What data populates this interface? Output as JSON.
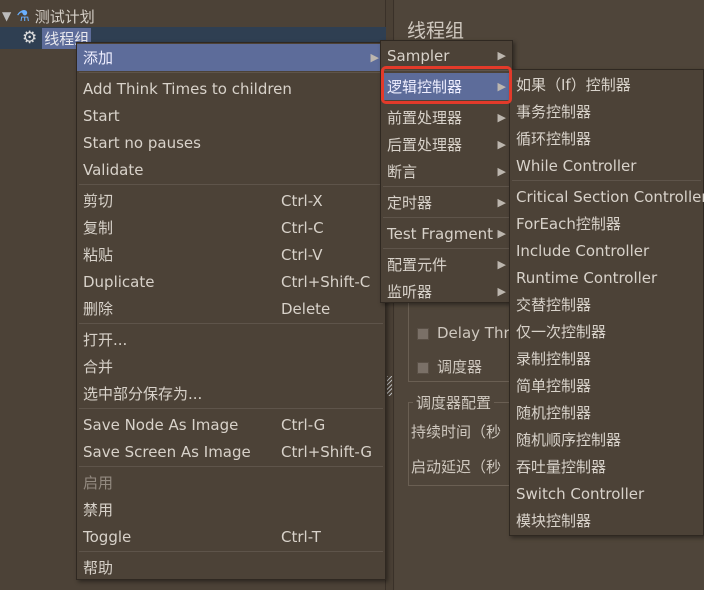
{
  "tree": {
    "root": "测试计划",
    "child": "线程组"
  },
  "panel": {
    "title": "线程组",
    "delay": "Delay Thre",
    "scheduler": "调度器",
    "sched_config": "调度器配置",
    "duration": "持续时间（秒",
    "startup_delay": "启动延迟（秒"
  },
  "menu1": [
    {
      "label": "添加",
      "sub": true,
      "hl": true
    },
    {
      "sep": true
    },
    {
      "label": "Add Think Times to children"
    },
    {
      "label": "Start"
    },
    {
      "label": "Start no pauses"
    },
    {
      "label": "Validate"
    },
    {
      "sep": true
    },
    {
      "label": "剪切",
      "shortcut": "Ctrl-X"
    },
    {
      "label": "复制",
      "shortcut": "Ctrl-C"
    },
    {
      "label": "粘贴",
      "shortcut": "Ctrl-V"
    },
    {
      "label": "Duplicate",
      "shortcut": "Ctrl+Shift-C"
    },
    {
      "label": "删除",
      "shortcut": "Delete"
    },
    {
      "sep": true
    },
    {
      "label": "打开..."
    },
    {
      "label": "合并"
    },
    {
      "label": "选中部分保存为..."
    },
    {
      "sep": true
    },
    {
      "label": "Save Node As Image",
      "shortcut": "Ctrl-G"
    },
    {
      "label": "Save Screen As Image",
      "shortcut": "Ctrl+Shift-G"
    },
    {
      "sep": true
    },
    {
      "label": "启用",
      "disabled": true
    },
    {
      "label": "禁用"
    },
    {
      "label": "Toggle",
      "shortcut": "Ctrl-T"
    },
    {
      "sep": true
    },
    {
      "label": "帮助"
    }
  ],
  "menu2": [
    {
      "label": "Sampler",
      "sub": true
    },
    {
      "sep": true
    },
    {
      "label": "逻辑控制器",
      "sub": true,
      "hl": true
    },
    {
      "sep": true
    },
    {
      "label": "前置处理器",
      "sub": true
    },
    {
      "label": "后置处理器",
      "sub": true
    },
    {
      "label": "断言",
      "sub": true
    },
    {
      "sep": true
    },
    {
      "label": "定时器",
      "sub": true
    },
    {
      "sep": true
    },
    {
      "label": "Test Fragment",
      "sub": true
    },
    {
      "sep": true
    },
    {
      "label": "配置元件",
      "sub": true
    },
    {
      "label": "监听器",
      "sub": true
    }
  ],
  "menu3": [
    {
      "label": "如果（If）控制器"
    },
    {
      "label": "事务控制器"
    },
    {
      "label": "循环控制器"
    },
    {
      "label": "While Controller"
    },
    {
      "sep": true
    },
    {
      "label": "Critical Section Controller"
    },
    {
      "label": "ForEach控制器"
    },
    {
      "label": "Include Controller"
    },
    {
      "label": "Runtime Controller"
    },
    {
      "label": "交替控制器"
    },
    {
      "label": "仅一次控制器"
    },
    {
      "label": "录制控制器"
    },
    {
      "label": "简单控制器"
    },
    {
      "label": "随机控制器"
    },
    {
      "label": "随机顺序控制器"
    },
    {
      "label": "吞吐量控制器"
    },
    {
      "label": "Switch Controller"
    },
    {
      "label": "模块控制器"
    }
  ],
  "colors": {
    "highlight": "#5d6c9a",
    "annotation": "#e33a2a"
  }
}
